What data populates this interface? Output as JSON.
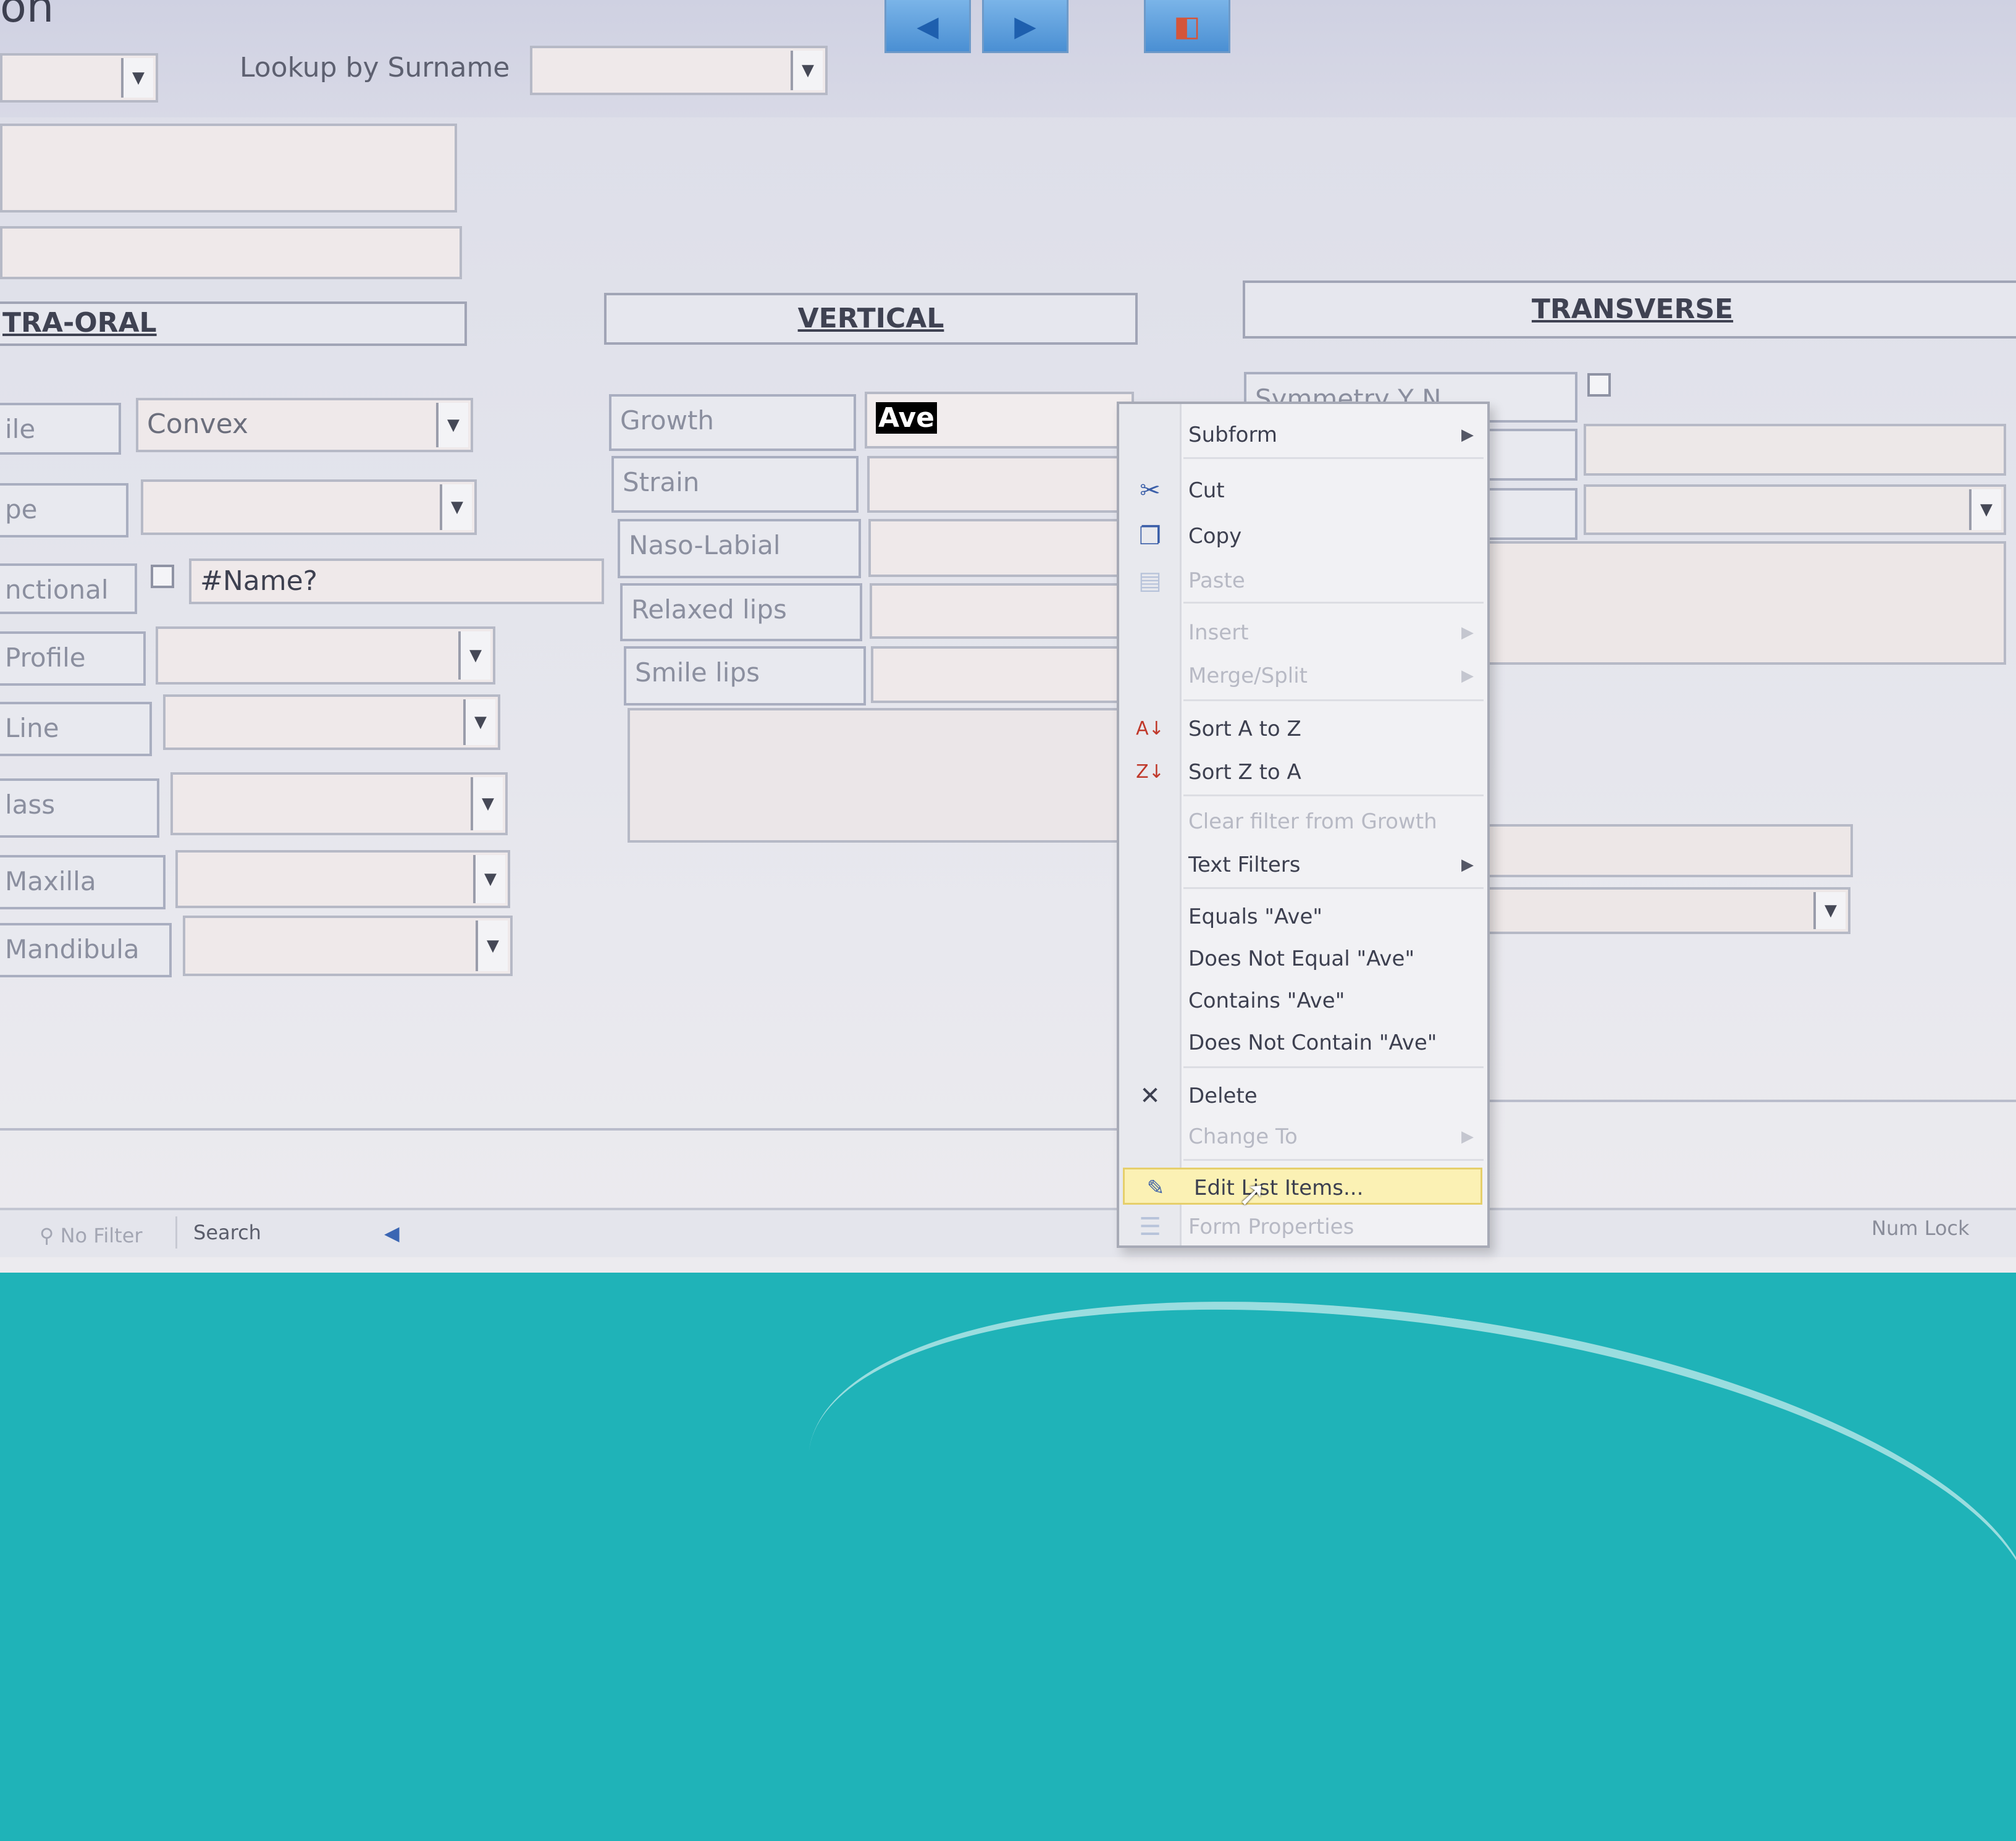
{
  "header": {
    "title_fragment": "on",
    "lookup_label": "Lookup by Surname",
    "lookup_value": ""
  },
  "sections": {
    "extra_oral": "TRA-ORAL",
    "vertical": "VERTICAL",
    "transverse": "TRANSVERSE"
  },
  "extra_oral": {
    "rows": [
      {
        "label": "ile",
        "value": "Convex"
      },
      {
        "label": "pe",
        "value": ""
      },
      {
        "label": "nctional",
        "value": "#Name?"
      },
      {
        "label": "Profile",
        "value": ""
      },
      {
        "label": "Line",
        "value": ""
      },
      {
        "label": "lass",
        "value": ""
      },
      {
        "label": "Maxilla",
        "value": ""
      },
      {
        "label": "Mandibula",
        "value": ""
      }
    ]
  },
  "vertical": {
    "rows": [
      {
        "label": "Growth",
        "value": "Ave"
      },
      {
        "label": "Strain",
        "value": ""
      },
      {
        "label": "Naso-Labial",
        "value": ""
      },
      {
        "label": "Relaxed lips",
        "value": ""
      },
      {
        "label": "Smile lips",
        "value": ""
      }
    ]
  },
  "transverse": {
    "symmetry_label": "Symmetry Y N"
  },
  "context_menu": {
    "items": [
      {
        "label": "Subform",
        "icon": "",
        "disabled": false,
        "submenu": true
      },
      {
        "label": "Cut",
        "icon": "scissors-icon",
        "disabled": false,
        "submenu": false
      },
      {
        "label": "Copy",
        "icon": "copy-icon",
        "disabled": false,
        "submenu": false
      },
      {
        "label": "Paste",
        "icon": "paste-icon",
        "disabled": true,
        "submenu": false
      },
      {
        "label": "Insert",
        "icon": "",
        "disabled": true,
        "submenu": true
      },
      {
        "label": "Merge/Split",
        "icon": "",
        "disabled": true,
        "submenu": true
      },
      {
        "label": "Sort A to Z",
        "icon": "sort-asc-icon",
        "disabled": false,
        "submenu": false
      },
      {
        "label": "Sort Z to A",
        "icon": "sort-desc-icon",
        "disabled": false,
        "submenu": false
      },
      {
        "label": "Clear filter from Growth",
        "icon": "",
        "disabled": true,
        "submenu": false
      },
      {
        "label": "Text Filters",
        "icon": "",
        "disabled": false,
        "submenu": true
      },
      {
        "label": "Equals \"Ave\"",
        "icon": "",
        "disabled": false,
        "submenu": false
      },
      {
        "label": "Does Not Equal \"Ave\"",
        "icon": "",
        "disabled": false,
        "submenu": false
      },
      {
        "label": "Contains \"Ave\"",
        "icon": "",
        "disabled": false,
        "submenu": false
      },
      {
        "label": "Does Not Contain \"Ave\"",
        "icon": "",
        "disabled": false,
        "submenu": false
      },
      {
        "label": "Delete",
        "icon": "delete-x-icon",
        "disabled": false,
        "submenu": false
      },
      {
        "label": "Change To",
        "icon": "",
        "disabled": true,
        "submenu": true
      },
      {
        "label": "Edit List Items...",
        "icon": "edit-list-icon",
        "disabled": false,
        "submenu": false
      },
      {
        "label": "Form Properties",
        "icon": "properties-icon",
        "disabled": true,
        "submenu": false
      }
    ]
  },
  "status_bar": {
    "no_filter": "No Filter",
    "search": "Search",
    "num_lock": "Num Lock"
  },
  "colors": {
    "highlight": "#fbf1b4",
    "selected_text_bg": "#000000",
    "desktop": "#1fb3b8"
  }
}
